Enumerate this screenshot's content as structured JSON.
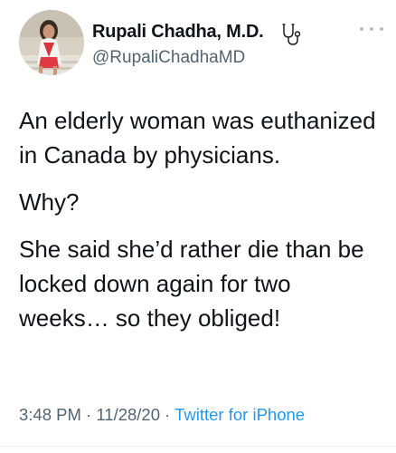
{
  "author": {
    "display_name": "Rupali Chadha, M.D.",
    "handle": "@RupaliChadhaMD",
    "badge_icon": "stethoscope-icon",
    "avatar_icon": "profile-photo"
  },
  "more_icon": "more-dots-icon",
  "tweet": {
    "paragraphs": [
      "An elderly woman was euthanized in Canada by physicians.",
      "Why?",
      "She said she’d rather die than be locked down again for two weeks… so they obliged!"
    ]
  },
  "meta": {
    "time": "3:48 PM",
    "separator_1": " · ",
    "date": "11/28/20",
    "separator_2": " · ",
    "source": "Twitter for iPhone"
  },
  "colors": {
    "text": "#0f1419",
    "secondary": "#536471",
    "link": "#1d9bf0"
  }
}
